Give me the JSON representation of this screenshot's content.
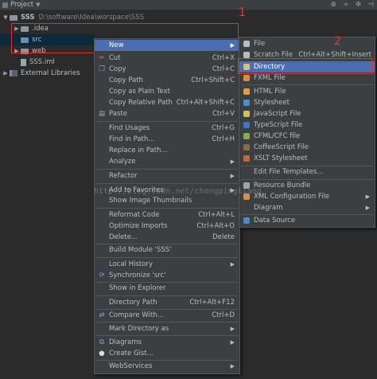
{
  "titlebar": {
    "label": "Project"
  },
  "tree": {
    "root_name": "SSS",
    "root_path": "D:\\software\\Idea\\worspace\\SSS",
    "items": [
      "idea",
      "src",
      "web",
      "SSS.iml"
    ],
    "idea_label": ".idea",
    "src_label": "src",
    "web_label": "web",
    "iml_label": "SSS.iml",
    "ext_label": "External Libraries"
  },
  "annotations": {
    "num1": "1",
    "num2": "2"
  },
  "watermark": "http://blog.csdn.net/chengpingliang",
  "context_menu": {
    "new": "New",
    "cut": "Cut",
    "cut_sc": "Ctrl+X",
    "copy": "Copy",
    "copy_sc": "Ctrl+C",
    "copy_path": "Copy Path",
    "copy_path_sc": "Ctrl+Shift+C",
    "copy_plain": "Copy as Plain Text",
    "copy_rel": "Copy Relative Path",
    "copy_rel_sc": "Ctrl+Alt+Shift+C",
    "paste": "Paste",
    "paste_sc": "Ctrl+V",
    "find_usages": "Find Usages",
    "find_usages_sc": "Ctrl+G",
    "find_in_path": "Find in Path...",
    "find_in_path_sc": "Ctrl+H",
    "replace_in_path": "Replace in Path...",
    "analyze": "Analyze",
    "refactor": "Refactor",
    "add_fav": "Add to Favorites",
    "show_thumbs": "Show Image Thumbnails",
    "reformat": "Reformat Code",
    "reformat_sc": "Ctrl+Alt+L",
    "optimize": "Optimize Imports",
    "optimize_sc": "Ctrl+Alt+O",
    "delete": "Delete...",
    "delete_sc": "Delete",
    "build": "Build Module 'SSS'",
    "local_history": "Local History",
    "sync": "Synchronize 'src'",
    "explorer": "Show in Explorer",
    "dir_path": "Directory Path",
    "dir_path_sc": "Ctrl+Alt+F12",
    "compare": "Compare With...",
    "compare_sc": "Ctrl+D",
    "mark_dir": "Mark Directory as",
    "diagrams": "Diagrams",
    "gist": "Create Gist...",
    "webservices": "WebServices"
  },
  "new_submenu": {
    "file": "File",
    "scratch": "Scratch File",
    "scratch_sc": "Ctrl+Alt+Shift+Insert",
    "directory": "Directory",
    "fxml": "FXML File",
    "html": "HTML File",
    "stylesheet": "Stylesheet",
    "js": "JavaScript File",
    "ts": "TypeScript File",
    "cfml": "CFML/CFC file",
    "coffee": "CoffeeScript File",
    "xslt": "XSLT Stylesheet",
    "edit_templates": "Edit File Templates...",
    "resource_bundle": "Resource Bundle",
    "xml_config": "XML Configuration File",
    "diagram": "Diagram",
    "data_source": "Data Source"
  },
  "colors": {
    "highlight": "#4b6eaf",
    "annotation_red": "#e0312c"
  }
}
